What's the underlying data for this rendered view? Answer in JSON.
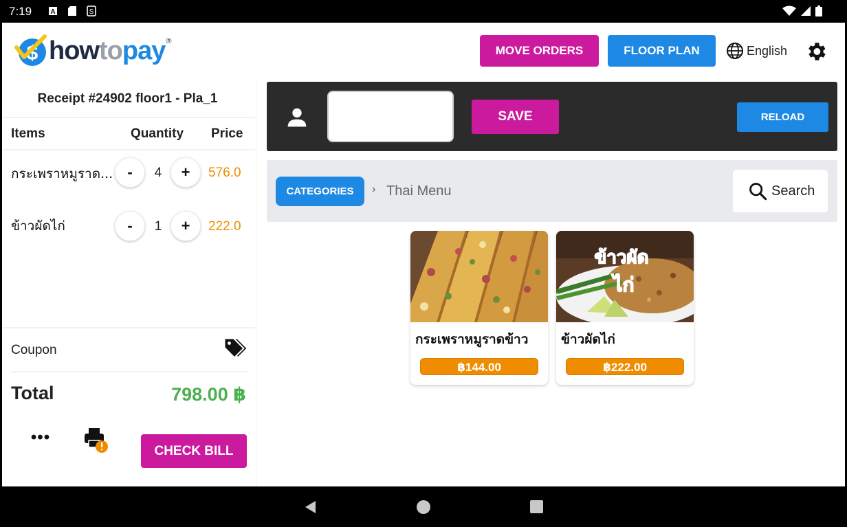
{
  "status_bar": {
    "time": "7:19",
    "icons": [
      "notification-a-icon",
      "sd-card-icon",
      "sync-icon"
    ],
    "right_icons": [
      "wifi-icon",
      "signal-icon",
      "battery-icon"
    ]
  },
  "header": {
    "logo": {
      "how": "how",
      "to": "to",
      "pay": "pay",
      "reg": "®"
    },
    "move_orders_label": "MOVE ORDERS",
    "floor_plan_label": "FLOOR PLAN",
    "language": "English",
    "settings_icon": "gear-icon"
  },
  "receipt": {
    "title": "Receipt #24902  floor1 - Pla_1",
    "col_items": "Items",
    "col_quantity": "Quantity",
    "col_price": "Price",
    "items": [
      {
        "name": "กระเพราหมูราด...",
        "minus": "-",
        "qty": "4",
        "plus": "+",
        "price": "576.0"
      },
      {
        "name": "ข้าวผัดไก่",
        "minus": "-",
        "qty": "1",
        "plus": "+",
        "price": "222.0"
      }
    ],
    "coupon_label": "Coupon",
    "total_label": "Total",
    "total_value": "798.00 ฿",
    "more_label": "•••",
    "check_bill_label": "CHECK BILL"
  },
  "toolbar": {
    "customer_value": "",
    "save_label": "SAVE",
    "reload_label": "RELOAD"
  },
  "catalog": {
    "categories_label": "CATEGORIES",
    "crumb_sep": "›",
    "current_category": "Thai Menu",
    "search_label": "Search",
    "products": [
      {
        "name": "กระเพราหมูราดข้าว",
        "price": "฿144.00"
      },
      {
        "name": "ข้าวผัดไก่",
        "price": "฿222.00",
        "image_text": "ข้าวผัด ไก่"
      }
    ]
  },
  "colors": {
    "magenta": "#cc1a9e",
    "blue": "#1e88e5",
    "orange": "#f08c00",
    "green": "#4caf50"
  }
}
